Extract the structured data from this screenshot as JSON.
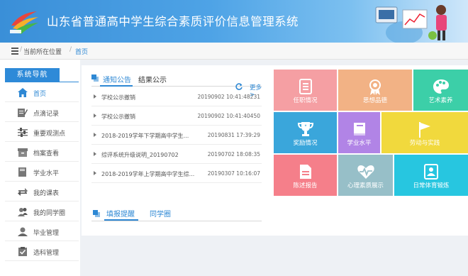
{
  "header": {
    "title": "山东省普通高中学生综合素质评价信息管理系统"
  },
  "breadcrumb": {
    "current_location": "当前所在位置",
    "home": "首页"
  },
  "sidebar": {
    "title": "系统导航",
    "items": [
      {
        "label": "首页",
        "icon": "home-icon"
      },
      {
        "label": "点滴记录",
        "icon": "note-edit-icon"
      },
      {
        "label": "重要观测点",
        "icon": "sliders-icon"
      },
      {
        "label": "档案查看",
        "icon": "archive-box-icon"
      },
      {
        "label": "学业水平",
        "icon": "book-icon"
      },
      {
        "label": "我的课表",
        "icon": "swap-icon"
      },
      {
        "label": "我的同学圈",
        "icon": "users-icon"
      },
      {
        "label": "毕业管理",
        "icon": "graduate-icon"
      },
      {
        "label": "选科管理",
        "icon": "clipboard-check-icon"
      }
    ]
  },
  "notices": {
    "tab_notice": "通知公告",
    "tab_public": "结果公示",
    "more": "更多>",
    "rows": [
      {
        "title": "学校公示撤销",
        "date": "20190902 10:41:48231"
      },
      {
        "title": "学校公示撤销",
        "date": "20190902 10:41:40450"
      },
      {
        "title": "2018-2019学年下学期高中学生...",
        "date": "20190831 17:39:29"
      },
      {
        "title": "综评系统升级说明_20190702",
        "date": "20190702 18:08:35"
      },
      {
        "title": "2018-2019学年上学期高中学生综...",
        "date": "20190307 10:16:07"
      }
    ]
  },
  "bottom_tabs": {
    "remind": "填报提醒",
    "circle": "同学圈"
  },
  "tiles": [
    {
      "label": "任职情况",
      "color": "#f59fa3",
      "icon": "badge-list-icon"
    },
    {
      "label": "思想品德",
      "color": "#f2b285",
      "icon": "award-ribbon-icon"
    },
    {
      "label": "艺术素养",
      "color": "#3ccfa8",
      "icon": "palette-icon"
    },
    {
      "label": "奖励情况",
      "color": "#3aa6db",
      "icon": "trophy-icon"
    },
    {
      "label": "学业水平",
      "color": "#b184e6",
      "icon": "book-icon"
    },
    {
      "label": "劳动与实践",
      "color": "#f1d93d",
      "icon": "flag-icon"
    },
    {
      "label": "陈述报告",
      "color": "#f57f8a",
      "icon": "document-icon"
    },
    {
      "label": "心理素质展示",
      "color": "#97bfc8",
      "icon": "heartbeat-icon"
    },
    {
      "label": "日常体育锻炼",
      "color": "#27c6e0",
      "icon": "id-card-icon"
    }
  ]
}
